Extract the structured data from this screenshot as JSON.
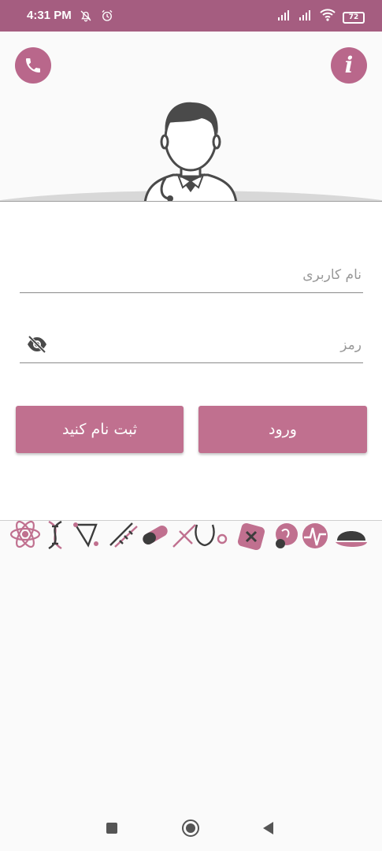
{
  "status_bar": {
    "time": "4:31 PM",
    "battery": "72",
    "icons": [
      "bell-off-icon",
      "alarm-icon",
      "signal-icon",
      "signal-icon",
      "wifi-icon",
      "battery-icon"
    ]
  },
  "header": {
    "phone_icon": "phone-icon",
    "info_icon": "info-icon",
    "avatar": "doctor-avatar"
  },
  "login_form": {
    "username_placeholder": "نام کاربری",
    "username_value": "",
    "password_placeholder": "رمز",
    "password_value": "",
    "toggle_visibility_icon": "eye-off-icon",
    "signup_label": "ثبت نام کنید",
    "login_label": "ورود"
  },
  "decoration": {
    "strip": "medical-icons-strip"
  },
  "nav_bar": {
    "icons": [
      "recents-icon",
      "home-icon",
      "back-icon"
    ]
  },
  "colors": {
    "status_bar": "#a55d80",
    "accent": "#c0708f",
    "icon_button": "#b9678b",
    "background": "#fafafa"
  }
}
